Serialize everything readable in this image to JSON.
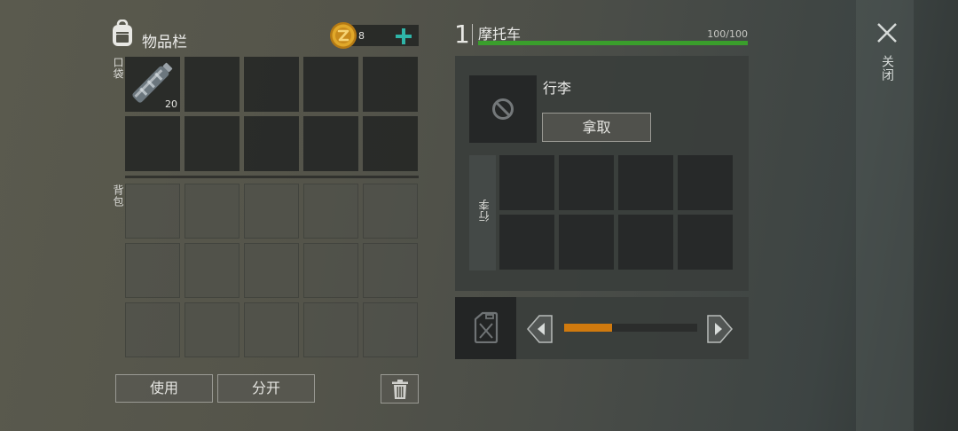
{
  "inventory": {
    "title": "物品栏",
    "coins": "8",
    "pocket_label": "口袋",
    "backpack_label": "背包",
    "item_count": "20",
    "use_label": "使用",
    "split_label": "分开"
  },
  "vehicle": {
    "index": "1",
    "name": "摩托车",
    "health_text": "100/100",
    "health_ratio": 1.0,
    "luggage_title": "行李",
    "take_label": "拿取",
    "luggage_side_label": "行李",
    "fuel_level": 0.36
  },
  "close_label": "关闭",
  "colors": {
    "health_bar": "#3a9e2c",
    "fuel_bar": "#d07a0e",
    "plus_accent": "#2fb5a8",
    "coin": "#e0a82a"
  }
}
